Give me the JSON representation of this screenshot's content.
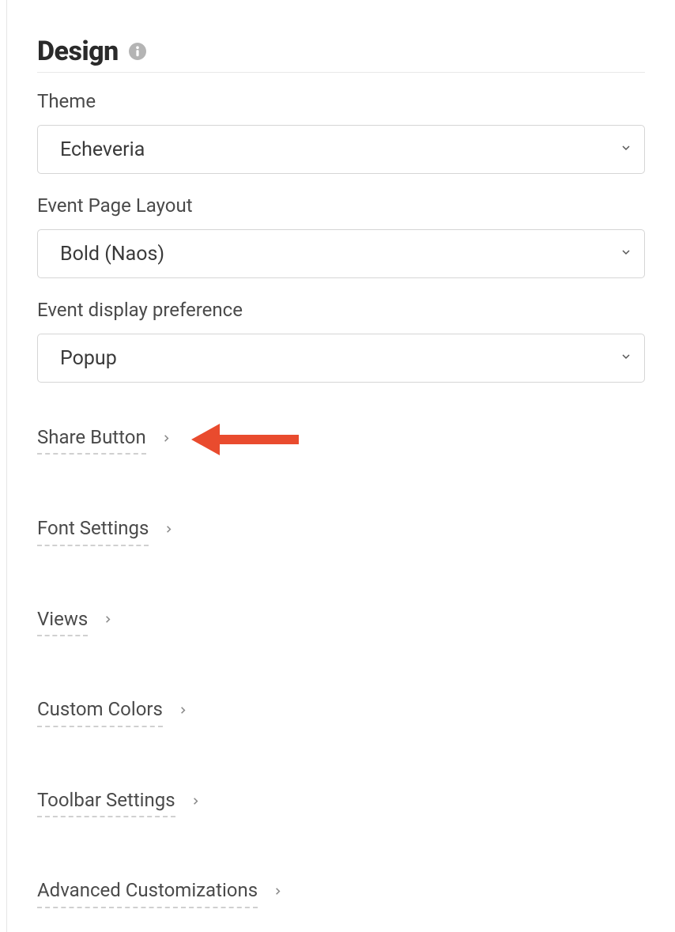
{
  "section": {
    "title": "Design"
  },
  "fields": {
    "theme": {
      "label": "Theme",
      "value": "Echeveria"
    },
    "eventPageLayout": {
      "label": "Event Page Layout",
      "value": "Bold (Naos)"
    },
    "eventDisplayPreference": {
      "label": "Event display preference",
      "value": "Popup"
    }
  },
  "expandItems": [
    {
      "label": "Share Button",
      "highlighted": true
    },
    {
      "label": "Font Settings",
      "highlighted": false
    },
    {
      "label": "Views",
      "highlighted": false
    },
    {
      "label": "Custom Colors",
      "highlighted": false
    },
    {
      "label": "Toolbar Settings",
      "highlighted": false
    },
    {
      "label": "Advanced Customizations",
      "highlighted": false
    }
  ]
}
